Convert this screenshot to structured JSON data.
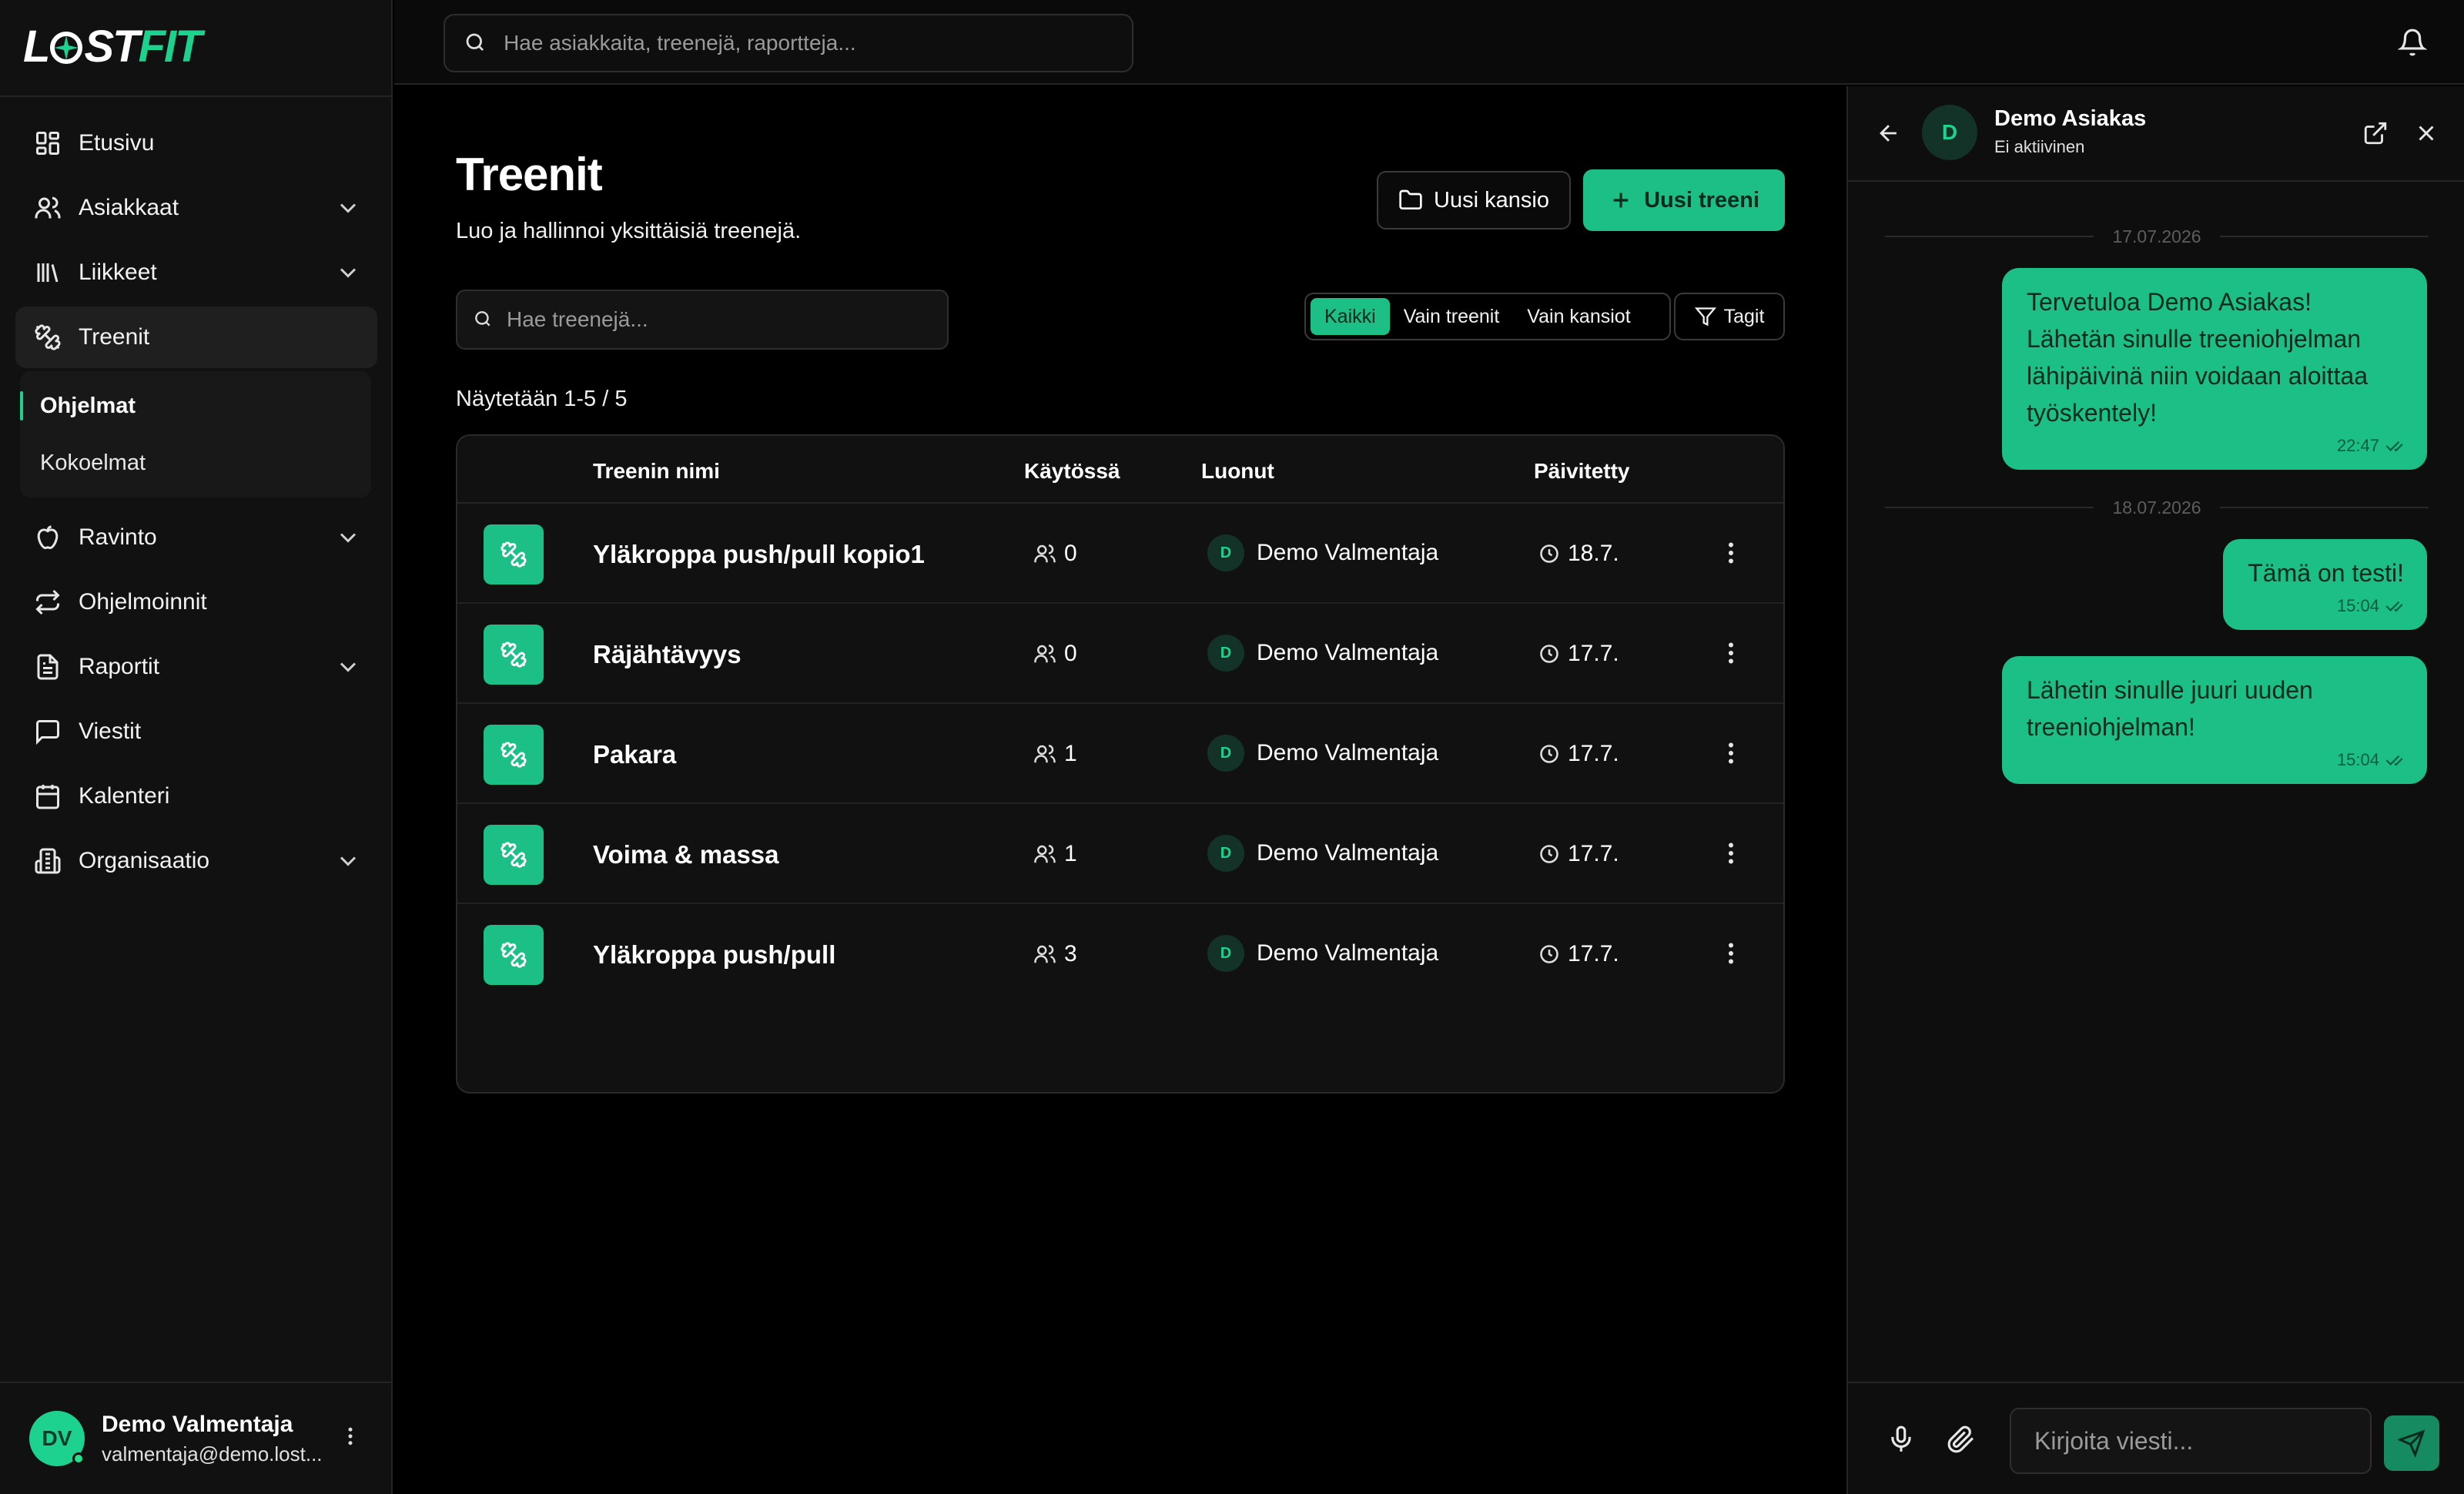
{
  "brand": {
    "logo_left": "L",
    "logo_mid": "ST",
    "logo_right": "FIT",
    "accent": "#1cbf85"
  },
  "sidebar": {
    "items": [
      {
        "label": "Etusivu",
        "icon": "dashboard-icon"
      },
      {
        "label": "Asiakkaat",
        "icon": "users-icon",
        "expandable": true
      },
      {
        "label": "Liikkeet",
        "icon": "library-icon",
        "expandable": true
      },
      {
        "label": "Treenit",
        "icon": "dumbbell-icon",
        "active": true
      },
      {
        "label": "Ravinto",
        "icon": "apple-icon",
        "expandable": true
      },
      {
        "label": "Ohjelmoinnit",
        "icon": "repeat-icon"
      },
      {
        "label": "Raportit",
        "icon": "file-text-icon",
        "expandable": true
      },
      {
        "label": "Viestit",
        "icon": "message-square-icon"
      },
      {
        "label": "Kalenteri",
        "icon": "calendar-icon"
      },
      {
        "label": "Organisaatio",
        "icon": "building-icon",
        "expandable": true
      }
    ],
    "subitems": [
      {
        "label": "Ohjelmat",
        "active": true
      },
      {
        "label": "Kokoelmat"
      }
    ],
    "user": {
      "initials": "DV",
      "name": "Demo Valmentaja",
      "email": "valmentaja@demo.lost..."
    }
  },
  "topbar": {
    "search_placeholder": "Hae asiakkaita, treenejä, raportteja..."
  },
  "main": {
    "title": "Treenit",
    "subtitle": "Luo ja hallinnoi yksittäisiä treenejä.",
    "new_folder_label": "Uusi kansio",
    "new_workout_label": "Uusi treeni",
    "search_placeholder": "Hae treenejä...",
    "filters": [
      "Kaikki",
      "Vain treenit",
      "Vain kansiot"
    ],
    "active_filter": "Kaikki",
    "tags_label": "Tagit",
    "count_text": "Näytetään 1-5 / 5",
    "columns": {
      "name": "Treenin nimi",
      "in_use": "Käytössä",
      "creator": "Luonut",
      "updated": "Päivitetty"
    },
    "rows": [
      {
        "name": "Yläkroppa push/pull kopio1",
        "uses": "0",
        "creator_initial": "D",
        "creator": "Demo Valmentaja",
        "updated": "18.7."
      },
      {
        "name": "Räjähtävyys",
        "uses": "0",
        "creator_initial": "D",
        "creator": "Demo Valmentaja",
        "updated": "17.7."
      },
      {
        "name": "Pakara",
        "uses": "1",
        "creator_initial": "D",
        "creator": "Demo Valmentaja",
        "updated": "17.7."
      },
      {
        "name": "Voima & massa",
        "uses": "1",
        "creator_initial": "D",
        "creator": "Demo Valmentaja",
        "updated": "17.7."
      },
      {
        "name": "Yläkroppa push/pull",
        "uses": "3",
        "creator_initial": "D",
        "creator": "Demo Valmentaja",
        "updated": "17.7."
      }
    ]
  },
  "chat": {
    "contact_initial": "D",
    "contact_name": "Demo Asiakas",
    "contact_status": "Ei aktiivinen",
    "dates": [
      "17.07.2026",
      "18.07.2026"
    ],
    "messages": [
      {
        "text": "Tervetuloa Demo Asiakas! Lähetän sinulle treeniohjelman lähipäivinä niin voidaan aloittaa työskentely!",
        "time": "22:47"
      },
      {
        "text": "Tämä on testi!",
        "time": "15:04"
      },
      {
        "text": "Lähetin sinulle juuri uuden treeniohjelman!",
        "time": "15:04"
      }
    ],
    "input_placeholder": "Kirjoita viesti..."
  }
}
